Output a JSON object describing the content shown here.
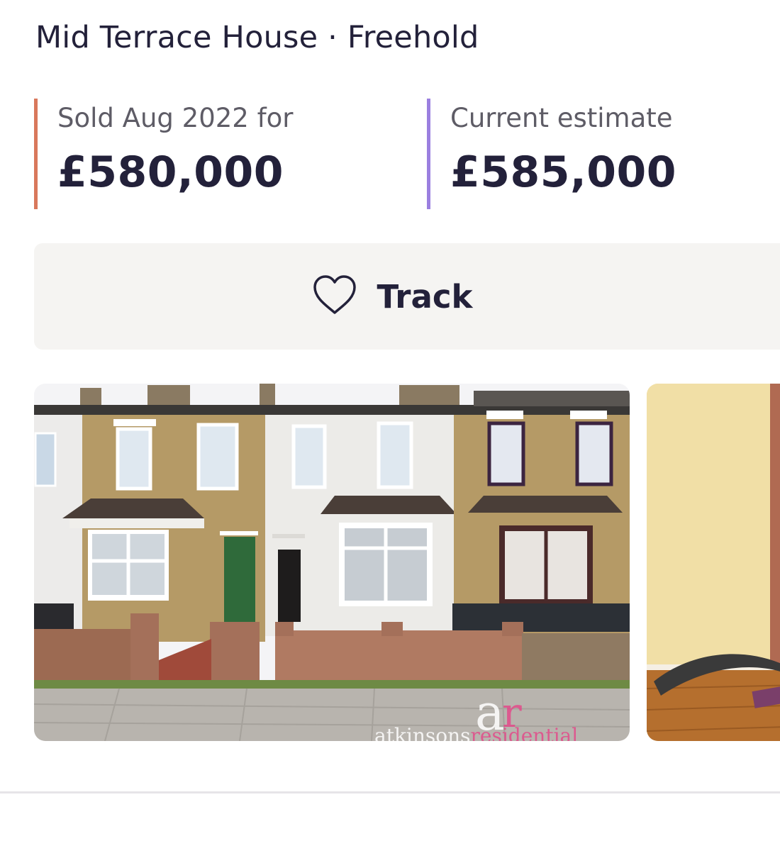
{
  "property": {
    "type_line": "Mid Terrace House · Freehold"
  },
  "sold": {
    "label": "Sold Aug 2022 for",
    "price": "£580,000",
    "accent_color": "#d9785c"
  },
  "estimate": {
    "label": "Current estimate",
    "price": "£585,000",
    "accent_color": "#9b7fe0"
  },
  "track_button": {
    "label": "Track",
    "icon": "heart-outline-icon"
  },
  "gallery": {
    "photos": [
      {
        "description_icon": "house-exterior-photo",
        "watermark": "atkinsonsresidential",
        "watermark_logo": "ar"
      },
      {
        "description_icon": "interior-room-photo"
      }
    ]
  }
}
